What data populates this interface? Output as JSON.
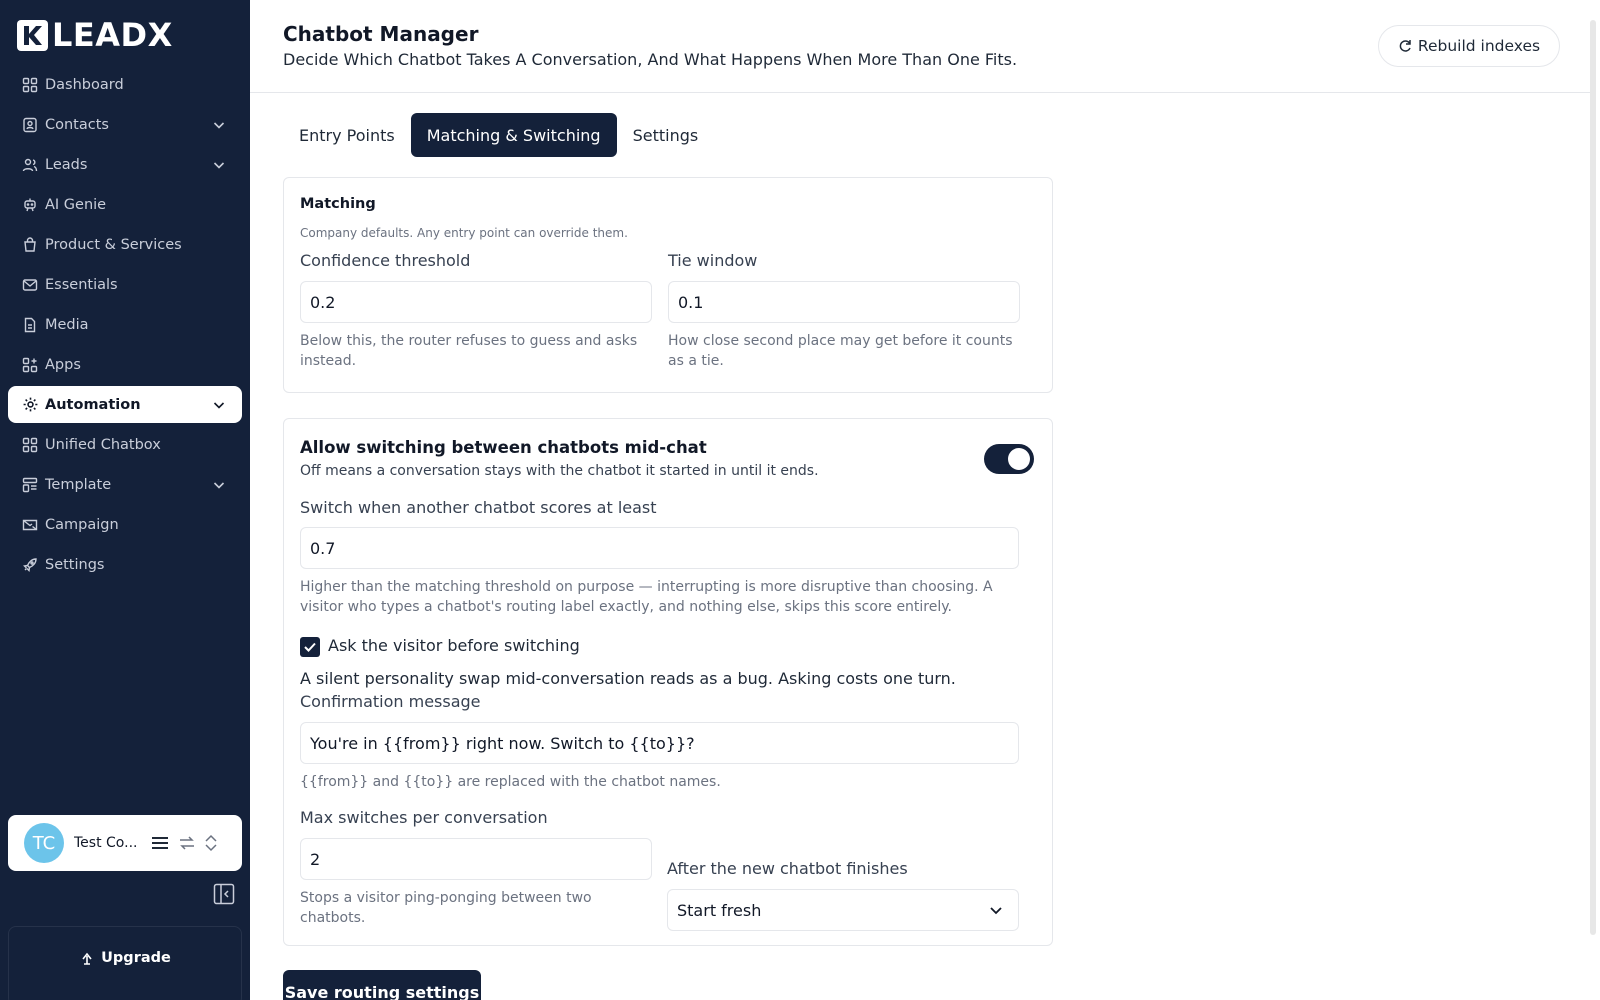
{
  "brand": {
    "name": "LEADX"
  },
  "sidebar": {
    "items": [
      {
        "label": "Dashboard",
        "icon": "grid-icon",
        "has_chevron": false
      },
      {
        "label": "Contacts",
        "icon": "contacts-icon",
        "has_chevron": true
      },
      {
        "label": "Leads",
        "icon": "users-icon",
        "has_chevron": true
      },
      {
        "label": "AI Genie",
        "icon": "bot-icon",
        "has_chevron": false
      },
      {
        "label": "Product & Services",
        "icon": "bag-icon",
        "has_chevron": false
      },
      {
        "label": "Essentials",
        "icon": "mail-icon",
        "has_chevron": false
      },
      {
        "label": "Media",
        "icon": "file-icon",
        "has_chevron": false
      },
      {
        "label": "Apps",
        "icon": "apps-icon",
        "has_chevron": false
      },
      {
        "label": "Automation",
        "icon": "gear-icon",
        "has_chevron": true,
        "active": true
      },
      {
        "label": "Unified Chatbox",
        "icon": "grid-icon",
        "has_chevron": false
      },
      {
        "label": "Template",
        "icon": "template-icon",
        "has_chevron": true
      },
      {
        "label": "Campaign",
        "icon": "campaign-icon",
        "has_chevron": false
      },
      {
        "label": "Settings",
        "icon": "rocket-icon",
        "has_chevron": false
      }
    ],
    "account": {
      "initials": "TC",
      "name": "Test Co..."
    },
    "upgrade_label": "Upgrade"
  },
  "header": {
    "title": "Chatbot Manager",
    "subtitle": "Decide Which Chatbot Takes A Conversation, And What Happens When More Than One Fits.",
    "rebuild_label": "Rebuild indexes"
  },
  "tabs": [
    {
      "label": "Entry Points",
      "active": false
    },
    {
      "label": "Matching & Switching",
      "active": true
    },
    {
      "label": "Settings",
      "active": false
    }
  ],
  "matching": {
    "title": "Matching",
    "subtitle": "Company defaults. Any entry point can override them.",
    "confidence": {
      "label": "Confidence threshold",
      "value": "0.2",
      "help": "Below this, the router refuses to guess and asks instead."
    },
    "tie": {
      "label": "Tie window",
      "value": "0.1",
      "help": "How close second place may get before it counts as a tie."
    }
  },
  "switching": {
    "title": "Allow switching between chatbots mid-chat",
    "subtitle": "Off means a conversation stays with the chatbot it started in until it ends.",
    "enabled": true,
    "threshold": {
      "label": "Switch when another chatbot scores at least",
      "value": "0.7",
      "help": "Higher than the matching threshold on purpose — interrupting is more disruptive than choosing. A visitor who types a chatbot's routing label exactly, and nothing else, skips this score entirely."
    },
    "ask_label": "Ask the visitor before switching",
    "ask_checked": true,
    "ask_note": "A silent personality swap mid-conversation reads as a bug. Asking costs one turn.",
    "confirmation": {
      "label": "Confirmation message",
      "value": "You're in {{from}} right now. Switch to {{to}}?",
      "help": "{{from}} and {{to}} are replaced with the chatbot names."
    },
    "max_switches": {
      "label": "Max switches per conversation",
      "value": "2",
      "help": "Stops a visitor ping-ponging between two chatbots."
    },
    "after_finish": {
      "label": "After the new chatbot finishes",
      "value": "Start fresh"
    }
  },
  "save_label": "Save routing settings",
  "colors": {
    "navy": "#14213a",
    "accent_avatar": "#6cc4ea"
  }
}
